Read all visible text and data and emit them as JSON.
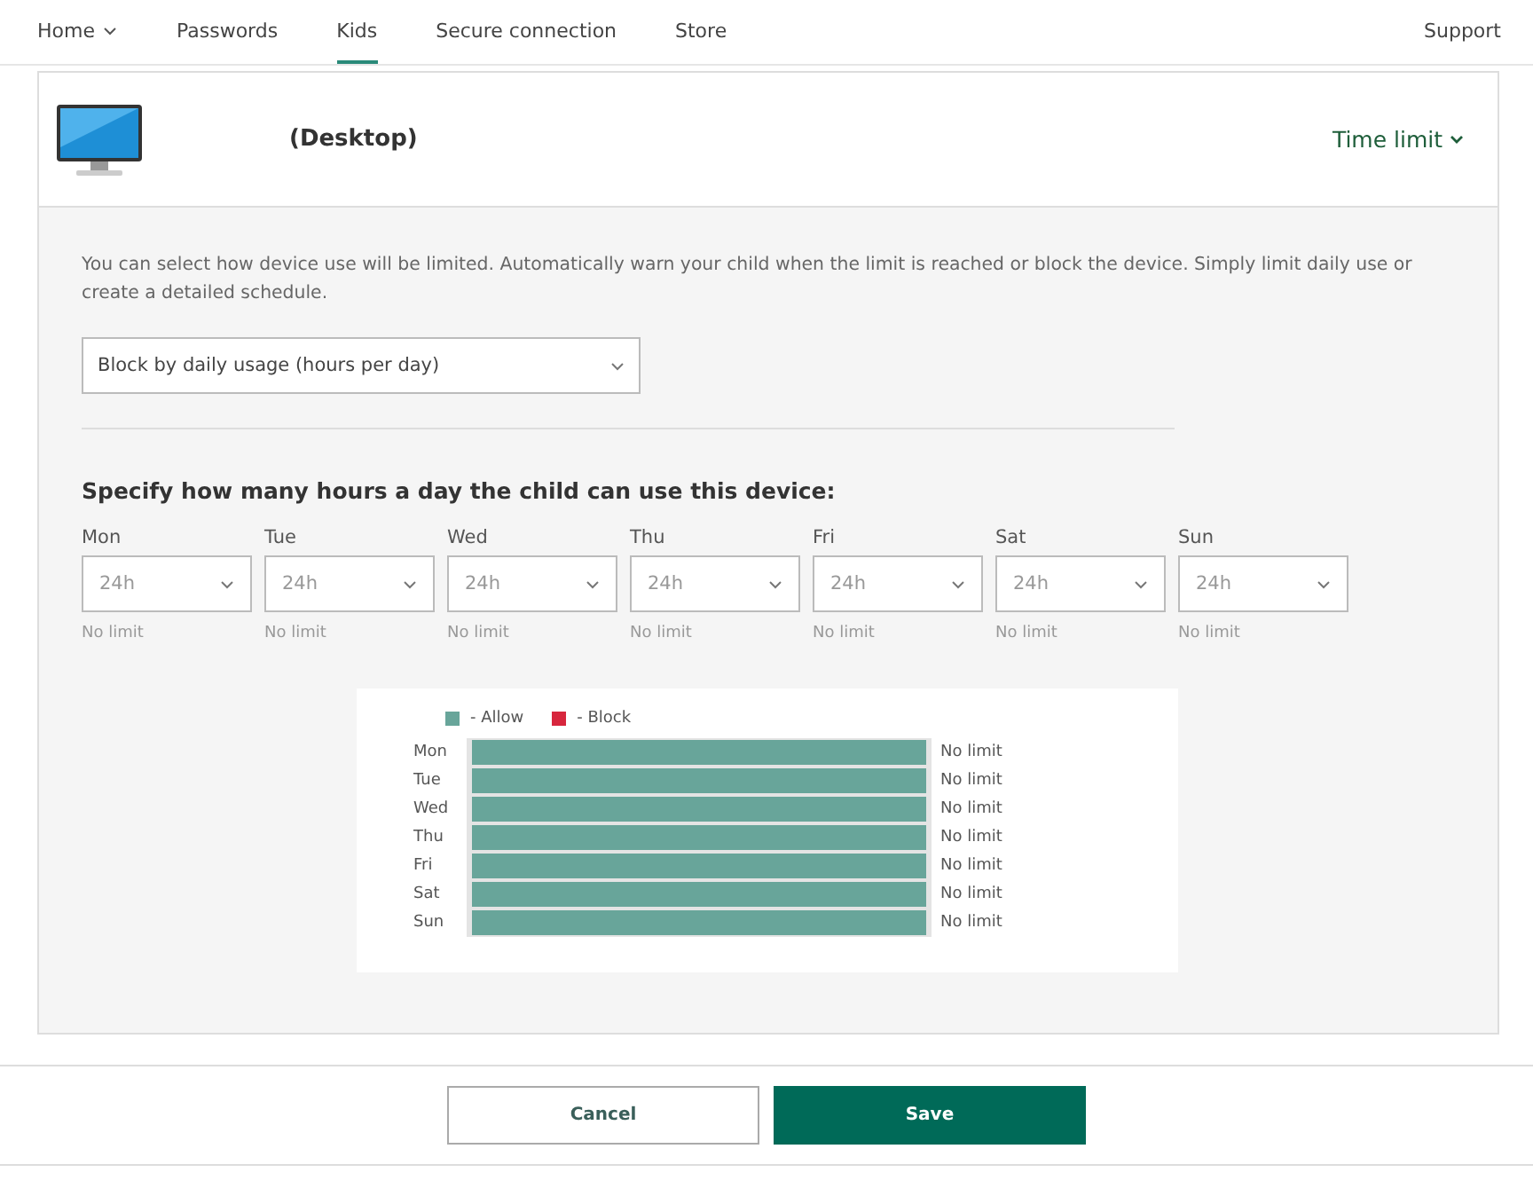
{
  "nav": {
    "items": [
      {
        "label": "Home",
        "dropdown": true,
        "selected": false
      },
      {
        "label": "Passwords",
        "dropdown": false,
        "selected": false
      },
      {
        "label": "Kids",
        "dropdown": false,
        "selected": true
      },
      {
        "label": "Secure connection",
        "dropdown": false,
        "selected": false
      },
      {
        "label": "Store",
        "dropdown": false,
        "selected": false
      }
    ],
    "support": "Support"
  },
  "device": {
    "name": "(Desktop)",
    "mode": "Time limit"
  },
  "description": "You can select how device use will be limited. Automatically warn your child when the limit is reached or block the device. Simply limit daily use or create a detailed schedule.",
  "limit_type": {
    "value": "Block by daily usage (hours per day)"
  },
  "heading": "Specify how many hours a day the child can use this device:",
  "days": [
    {
      "label": "Mon",
      "value": "24h",
      "note": "No limit"
    },
    {
      "label": "Tue",
      "value": "24h",
      "note": "No limit"
    },
    {
      "label": "Wed",
      "value": "24h",
      "note": "No limit"
    },
    {
      "label": "Thu",
      "value": "24h",
      "note": "No limit"
    },
    {
      "label": "Fri",
      "value": "24h",
      "note": "No limit"
    },
    {
      "label": "Sat",
      "value": "24h",
      "note": "No limit"
    },
    {
      "label": "Sun",
      "value": "24h",
      "note": "No limit"
    }
  ],
  "schedule": {
    "legend": [
      {
        "label": "- Allow",
        "color": "#68a59a"
      },
      {
        "label": "- Block",
        "color": "#d7263d"
      }
    ],
    "rows": [
      {
        "day": "Mon",
        "level": 1,
        "reading": "No limit"
      },
      {
        "day": "Tue",
        "level": 1,
        "reading": "No limit"
      },
      {
        "day": "Wed",
        "level": 1,
        "reading": "No limit"
      },
      {
        "day": "Thu",
        "level": 1,
        "reading": "No limit"
      },
      {
        "day": "Fri",
        "level": 1,
        "reading": "No limit"
      },
      {
        "day": "Sat",
        "level": 1,
        "reading": "No limit"
      },
      {
        "day": "Sun",
        "level": 1,
        "reading": "No limit"
      }
    ]
  },
  "buttons": [
    {
      "label": "Cancel",
      "kind": "secondary"
    },
    {
      "label": "Save",
      "kind": "primary"
    }
  ]
}
